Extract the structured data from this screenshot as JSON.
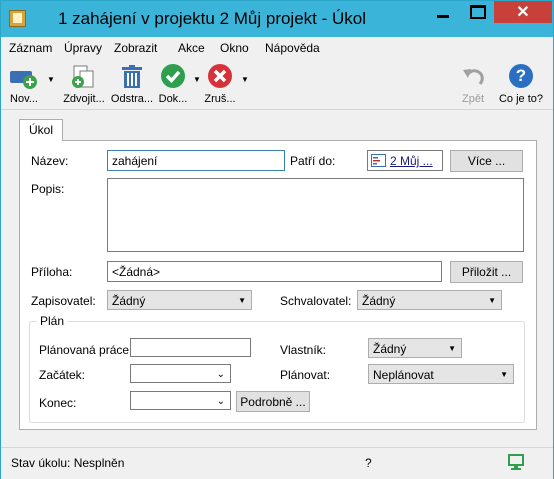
{
  "window": {
    "title": "1 zahájení v projektu 2 Můj projekt - Úkol",
    "minimize_glyph": "",
    "close_glyph": "✕"
  },
  "menu": [
    "Záznam",
    "Úpravy",
    "Zobrazit",
    "Akce",
    "Okno",
    "Nápověda"
  ],
  "toolbar": {
    "new_label": "Nov...",
    "duplicate_label": "Zdvojit...",
    "remove_label": "Odstra...",
    "complete_label": "Dok...",
    "cancel_label": "Zruš...",
    "back_label": "Zpět",
    "help_label": "Co je to?",
    "help_glyph": "?"
  },
  "tab": {
    "label": "Úkol"
  },
  "form": {
    "name_label": "Název:",
    "name_value": "zahájení",
    "belongs_label": "Patří do:",
    "belongs_value": "2 Můj ...",
    "more_button": "Více ...",
    "description_label": "Popis:",
    "description_value": "",
    "attachment_label": "Příloha:",
    "attachment_value": "<Žádná>",
    "attach_button": "Přiložit ...",
    "recorder_label": "Zapisovatel:",
    "recorder_value": "Žádný",
    "approver_label": "Schvalovatel:",
    "approver_value": "Žádný"
  },
  "plan": {
    "group_title": "Plán",
    "planned_work_label": "Plánovaná práce:",
    "planned_work_value": "",
    "start_label": "Začátek:",
    "start_value": "",
    "end_label": "Konec:",
    "end_value": "",
    "detail_button": "Podrobně ...",
    "owner_label": "Vlastník:",
    "owner_value": "Žádný",
    "schedule_label": "Plánovat:",
    "schedule_value": "Neplánovat"
  },
  "status": {
    "text": "Stav úkolu: Nesplněn",
    "middle": "?"
  },
  "colors": {
    "titlebar": "#3bb4d9",
    "close_button": "#c7403a",
    "accept_green": "#2f9e4f",
    "cancel_red": "#d6323a",
    "help_blue": "#2a6fc2"
  }
}
